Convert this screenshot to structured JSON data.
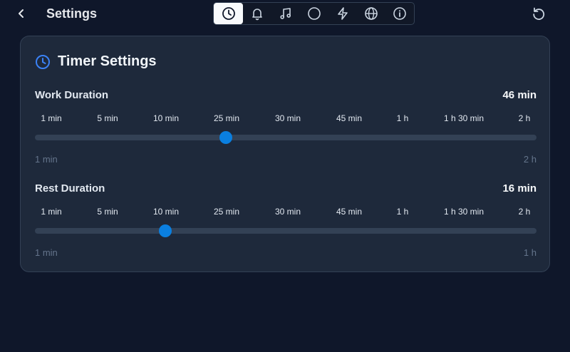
{
  "header": {
    "title": "Settings",
    "tabs": [
      {
        "icon": "clock-icon",
        "active": true
      },
      {
        "icon": "bell-icon",
        "active": false
      },
      {
        "icon": "music-icon",
        "active": false
      },
      {
        "icon": "circle-icon",
        "active": false
      },
      {
        "icon": "lightning-icon",
        "active": false
      },
      {
        "icon": "globe-icon",
        "active": false
      },
      {
        "icon": "info-icon",
        "active": false
      }
    ]
  },
  "card": {
    "title": "Timer Settings",
    "accent_color": "#3b82f6"
  },
  "tick_labels": [
    "1 min",
    "5 min",
    "10 min",
    "25 min",
    "30 min",
    "45 min",
    "1 h",
    "1 h 30 min",
    "2 h"
  ],
  "work": {
    "label": "Work Duration",
    "value": "46 min",
    "position_fraction": 0.38,
    "range_min": "1 min",
    "range_max": "2 h"
  },
  "rest": {
    "label": "Rest Duration",
    "value": "16 min",
    "position_fraction": 0.26,
    "range_min": "1 min",
    "range_max": "1 h"
  },
  "colors": {
    "background": "#0f172a",
    "card": "#1e293b",
    "slider_thumb": "#0a7fe0",
    "track": "#334155"
  }
}
